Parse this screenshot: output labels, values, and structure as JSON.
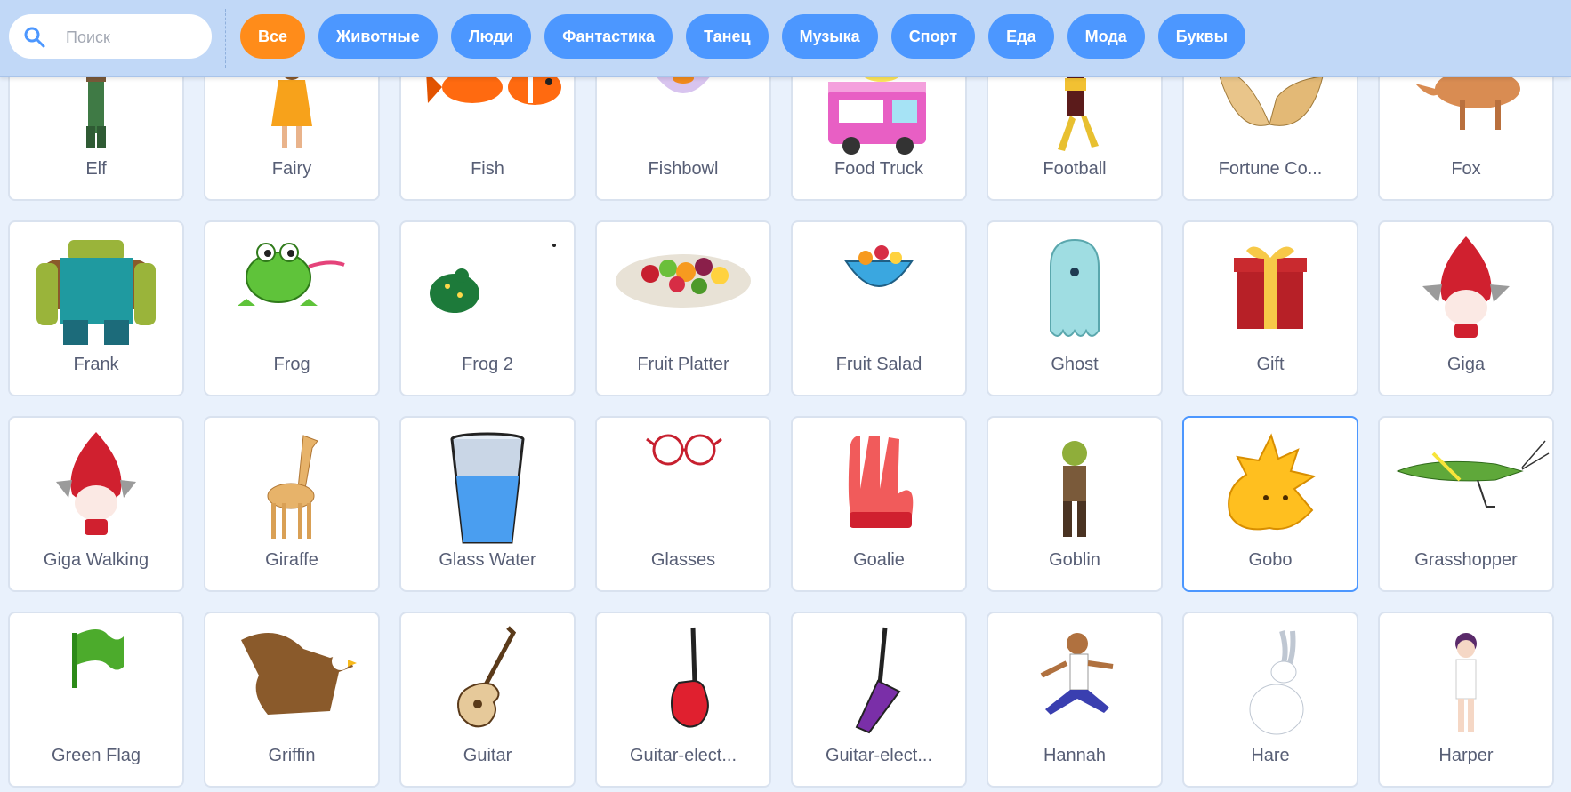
{
  "search": {
    "placeholder": "Поиск",
    "icon": "search-icon"
  },
  "tags": [
    {
      "label": "Все",
      "active": true
    },
    {
      "label": "Животные"
    },
    {
      "label": "Люди"
    },
    {
      "label": "Фантастика"
    },
    {
      "label": "Танец"
    },
    {
      "label": "Музыка"
    },
    {
      "label": "Спорт"
    },
    {
      "label": "Еда"
    },
    {
      "label": "Мода"
    },
    {
      "label": "Буквы"
    }
  ],
  "colors": {
    "accent": "#4c97ff",
    "active_tag": "#ff8c1a",
    "background": "#e9f1fc",
    "header": "#c1d8f7"
  },
  "sprites": {
    "row1": [
      "Elf",
      "Fairy",
      "Fish",
      "Fishbowl",
      "Food Truck",
      "Football",
      "Fortune Co...",
      "Fox"
    ],
    "row2": [
      "Frank",
      "Frog",
      "Frog 2",
      "Fruit Platter",
      "Fruit Salad",
      "Ghost",
      "Gift",
      "Giga"
    ],
    "row3": [
      "Giga Walking",
      "Giraffe",
      "Glass Water",
      "Glasses",
      "Goalie",
      "Goblin",
      "Gobo",
      "Grasshopper"
    ],
    "row4": [
      "Green Flag",
      "Griffin",
      "Guitar",
      "Guitar-elect...",
      "Guitar-elect...",
      "Hannah",
      "Hare",
      "Harper"
    ]
  },
  "selected_sprite": "Gobo"
}
